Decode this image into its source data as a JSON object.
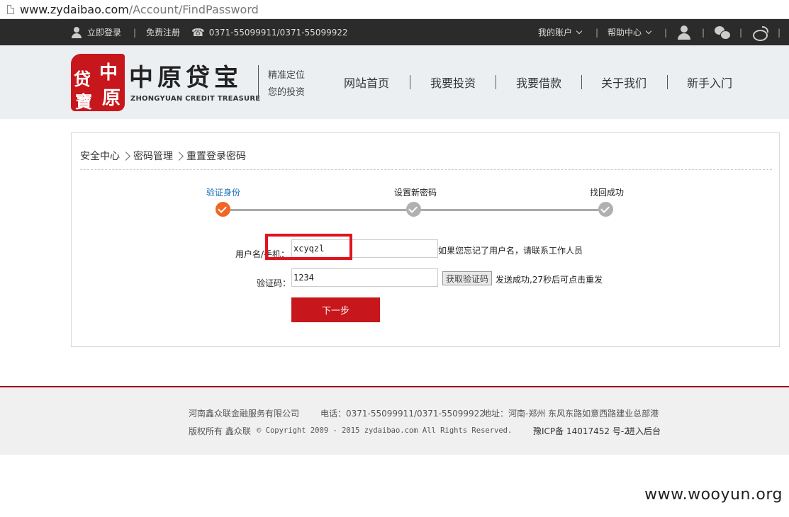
{
  "browser": {
    "url_host": "www.zydaibao.com",
    "url_path": "/Account/FindPassword"
  },
  "topbar": {
    "login": "立即登录",
    "separator": "|",
    "register": "免费注册",
    "phone": "0371-55099911/0371-55099922",
    "my_account": "我的账户",
    "help_center": "帮助中心"
  },
  "header": {
    "logo_seal_chars": [
      "贷",
      "中",
      "寶",
      "原"
    ],
    "logo_title": "中原贷宝",
    "logo_subtitle": "ZHONGYUAN CREDIT TREASURE",
    "slogan_line1": "精准定位",
    "slogan_line2": "您的投资",
    "nav": [
      "网站首页",
      "我要投资",
      "我要借款",
      "关于我们",
      "新手入门"
    ]
  },
  "breadcrumb": [
    "安全中心",
    "密码管理",
    "重置登录密码"
  ],
  "steps": [
    {
      "label": "验证身份",
      "state": "active"
    },
    {
      "label": "设置新密码",
      "state": "pending"
    },
    {
      "label": "找回成功",
      "state": "pending"
    }
  ],
  "form": {
    "username_label": "用户名/手机：",
    "username_value": "xcyqzl",
    "username_hint": "如果您忘记了用户名，请联系工作人员",
    "code_label": "验证码：",
    "code_value": "1234",
    "get_code_button": "获取验证码",
    "code_status": "发送成功,27秒后可点击重发",
    "next_button": "下一步"
  },
  "footer": {
    "company": "河南鑫众联金融服务有限公司",
    "phone": "电话：0371-55099911/0371-55099922",
    "address": "地址：河南-郑州 东风东路如意西路建业总部港",
    "copyright_prefix": "版权所有 鑫众联",
    "copyright": "© Copyright 2009 - 2015 zydaibao.com All Rights Reserved.",
    "icp": "豫ICP备 14017452 号-2",
    "admin_link": "进入后台"
  },
  "watermark": "www.wooyun.org",
  "colors": {
    "brand_red": "#c8161d",
    "active_step": "#f26522",
    "topbar_bg": "#2b2b2b",
    "highlight_box": "#e0141e"
  }
}
